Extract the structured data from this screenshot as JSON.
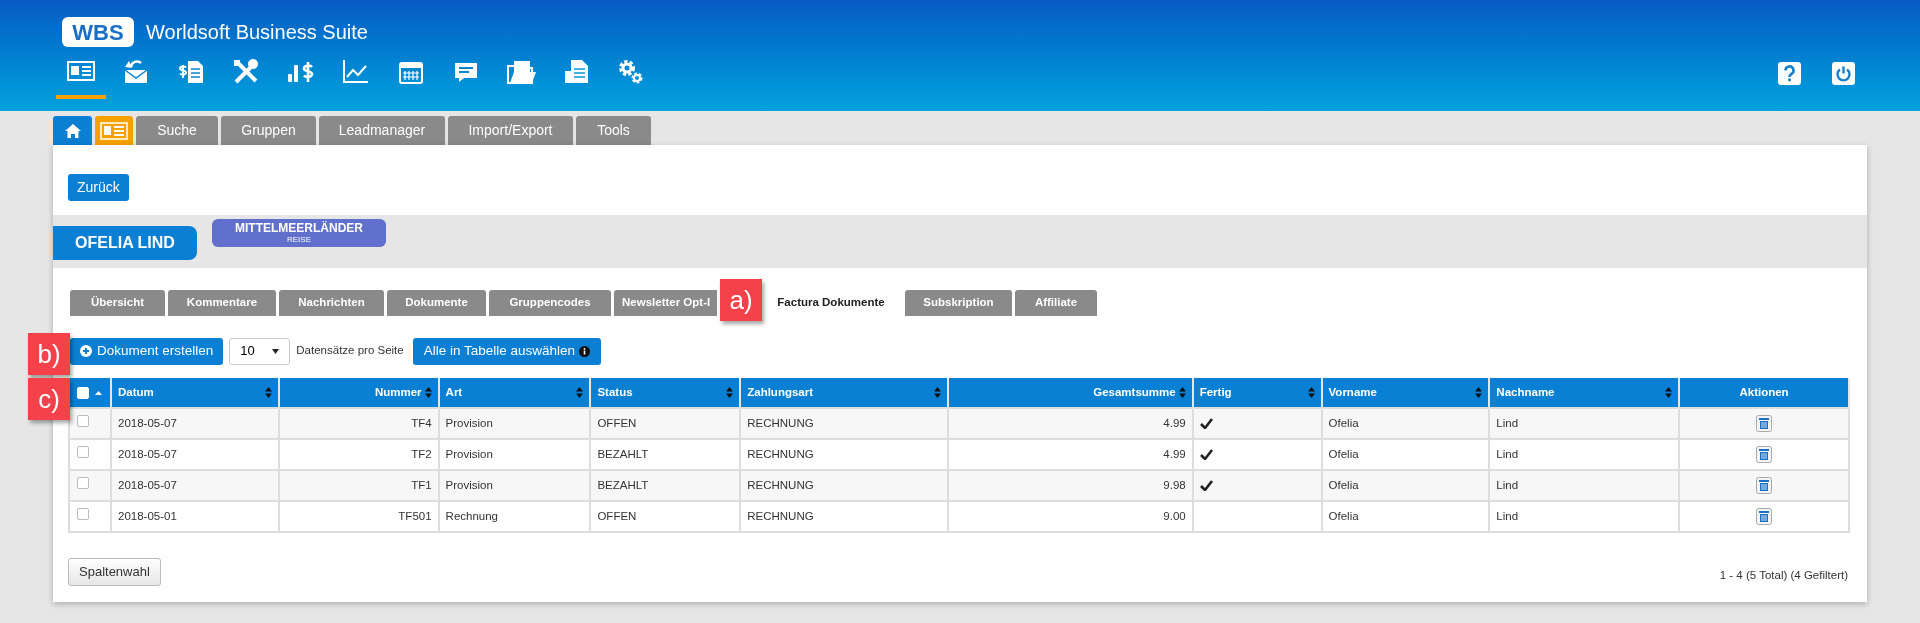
{
  "app": {
    "logo": "WBS",
    "title": "Worldsoft Business Suite"
  },
  "app_icons": [
    {
      "kind": "contact-card",
      "selected": true
    },
    {
      "kind": "mail",
      "selected": false
    },
    {
      "kind": "invoice",
      "selected": false
    },
    {
      "kind": "tools",
      "selected": false
    },
    {
      "kind": "sales",
      "selected": false
    },
    {
      "kind": "chart",
      "selected": false
    },
    {
      "kind": "calendar",
      "selected": false
    },
    {
      "kind": "comment",
      "selected": false
    },
    {
      "kind": "folder",
      "selected": false
    },
    {
      "kind": "document",
      "selected": false
    },
    {
      "kind": "settings",
      "selected": false
    }
  ],
  "top_tabs": [
    {
      "kind": "home",
      "selected": false
    },
    {
      "kind": "contact",
      "selected": true
    },
    {
      "kind": "text",
      "label": "Suche",
      "selected": false
    },
    {
      "kind": "text",
      "label": "Gruppen",
      "selected": false
    },
    {
      "kind": "text",
      "label": "Leadmanager",
      "selected": false
    },
    {
      "kind": "text",
      "label": "Import/Export",
      "selected": false
    },
    {
      "kind": "text",
      "label": "Tools",
      "selected": false
    }
  ],
  "back_button": "Zurück",
  "contact": {
    "name": "OFELIA LIND",
    "tag": {
      "title": "MITTELMEERLÄNDER",
      "subtitle": "REISE"
    }
  },
  "sub_tabs": [
    {
      "label": "Übersicht",
      "selected": false
    },
    {
      "label": "Kommentare",
      "selected": false
    },
    {
      "label": "Nachrichten",
      "selected": false
    },
    {
      "label": "Dokumente",
      "selected": false
    },
    {
      "label": "Gruppencodes",
      "selected": false
    },
    {
      "label": "Newsletter Opt-I",
      "selected": false
    },
    {
      "label": "Factura Dokumente",
      "selected": true
    },
    {
      "label": "Subskription",
      "selected": false
    },
    {
      "label": "Affiliate",
      "selected": false
    }
  ],
  "markers": [
    "a)",
    "b)",
    "c)"
  ],
  "toolbar": {
    "create_button": "Dokument erstellen",
    "page_size": "10",
    "page_size_label": "Datensätze pro Seite",
    "select_all_button": "Alle in Tabelle auswählen"
  },
  "table": {
    "all_checked": false,
    "columns": [
      "Datum",
      "Nummer",
      "Art",
      "Status",
      "Zahlungsart",
      "Gesamtsumme",
      "Fertig",
      "Vorname",
      "Nachname",
      "Aktionen"
    ],
    "rows": [
      {
        "checked": false,
        "cells": [
          "2018-05-07",
          "TF4",
          "Provision",
          "OFFEN",
          "RECHNUNG",
          "4.99"
        ],
        "done": true,
        "first_name": "Ofelia",
        "last_name": "Lind"
      },
      {
        "checked": false,
        "cells": [
          "2018-05-07",
          "TF2",
          "Provision",
          "BEZAHLT",
          "RECHNUNG",
          "4.99"
        ],
        "done": true,
        "first_name": "Ofelia",
        "last_name": "Lind"
      },
      {
        "checked": false,
        "cells": [
          "2018-05-07",
          "TF1",
          "Provision",
          "BEZAHLT",
          "RECHNUNG",
          "9.98"
        ],
        "done": true,
        "first_name": "Ofelia",
        "last_name": "Lind"
      },
      {
        "checked": false,
        "cells": [
          "2018-05-01",
          "TF501",
          "Rechnung",
          "OFFEN",
          "RECHNUNG",
          "9.00"
        ],
        "done": false,
        "first_name": "Ofelia",
        "last_name": "Lind"
      }
    ]
  },
  "column_button": "Spaltenwahl",
  "pagination": "1 - 4 (5 Total) (4 Gefiltert)"
}
